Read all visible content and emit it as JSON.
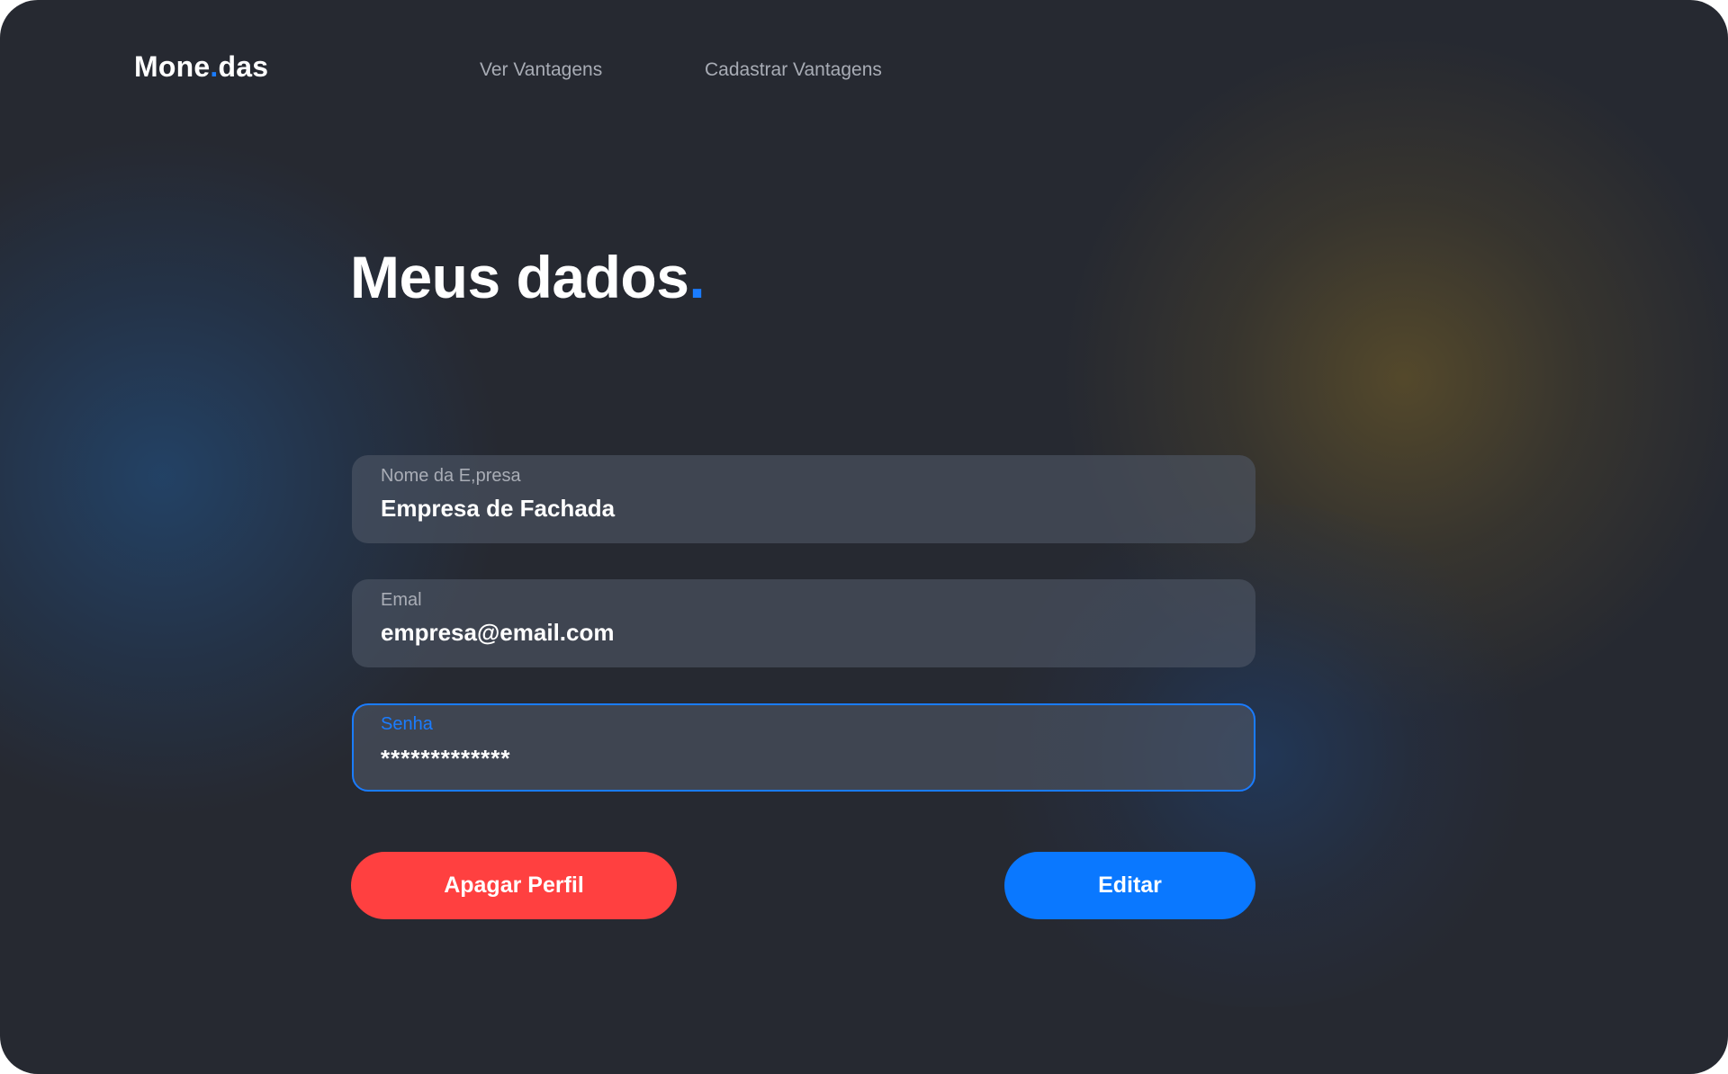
{
  "brand": {
    "logo_left": "Mone",
    "logo_dot": ".",
    "logo_right": "das"
  },
  "nav": {
    "items": [
      {
        "label": "Ver Vantagens"
      },
      {
        "label": "Cadastrar Vantagens"
      }
    ]
  },
  "page": {
    "title": "Meus dados",
    "title_dot": "."
  },
  "form": {
    "company_name": {
      "label": "Nome da E,presa",
      "value": "Empresa de Fachada"
    },
    "email": {
      "label": "Emal",
      "value": "empresa@email.com"
    },
    "password": {
      "label": "Senha",
      "value": "*************",
      "focused": true
    }
  },
  "actions": {
    "delete_label": "Apagar Perfil",
    "edit_label": "Editar"
  },
  "colors": {
    "background": "#262931",
    "accent": "#1a7cff",
    "danger": "#ff4040",
    "primary": "#0a78ff",
    "field_bg": "#454b58"
  }
}
